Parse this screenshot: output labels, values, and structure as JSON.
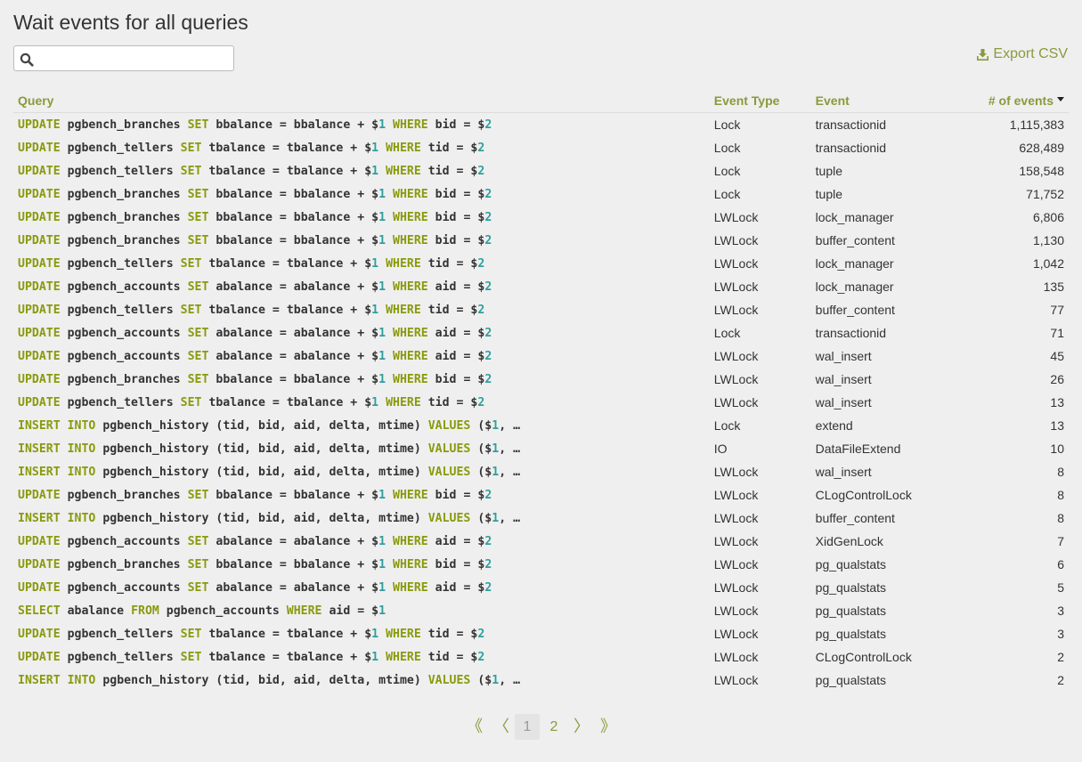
{
  "page": {
    "title": "Wait events for all queries"
  },
  "search": {
    "value": "",
    "placeholder": ""
  },
  "toolbar": {
    "export_label": "Export CSV"
  },
  "table": {
    "headers": {
      "query": "Query",
      "event_type": "Event Type",
      "event": "Event",
      "count": "# of events"
    },
    "sort": {
      "column": "count",
      "direction": "desc"
    },
    "rows": [
      {
        "query": "UPDATE pgbench_branches SET bbalance = bbalance + $1 WHERE bid = $2",
        "event_type": "Lock",
        "event": "transactionid",
        "count": "1,115,383"
      },
      {
        "query": "UPDATE pgbench_tellers SET tbalance = tbalance + $1 WHERE tid = $2",
        "event_type": "Lock",
        "event": "transactionid",
        "count": "628,489"
      },
      {
        "query": "UPDATE pgbench_tellers SET tbalance = tbalance + $1 WHERE tid = $2",
        "event_type": "Lock",
        "event": "tuple",
        "count": "158,548"
      },
      {
        "query": "UPDATE pgbench_branches SET bbalance = bbalance + $1 WHERE bid = $2",
        "event_type": "Lock",
        "event": "tuple",
        "count": "71,752"
      },
      {
        "query": "UPDATE pgbench_branches SET bbalance = bbalance + $1 WHERE bid = $2",
        "event_type": "LWLock",
        "event": "lock_manager",
        "count": "6,806"
      },
      {
        "query": "UPDATE pgbench_branches SET bbalance = bbalance + $1 WHERE bid = $2",
        "event_type": "LWLock",
        "event": "buffer_content",
        "count": "1,130"
      },
      {
        "query": "UPDATE pgbench_tellers SET tbalance = tbalance + $1 WHERE tid = $2",
        "event_type": "LWLock",
        "event": "lock_manager",
        "count": "1,042"
      },
      {
        "query": "UPDATE pgbench_accounts SET abalance = abalance + $1 WHERE aid = $2",
        "event_type": "LWLock",
        "event": "lock_manager",
        "count": "135"
      },
      {
        "query": "UPDATE pgbench_tellers SET tbalance = tbalance + $1 WHERE tid = $2",
        "event_type": "LWLock",
        "event": "buffer_content",
        "count": "77"
      },
      {
        "query": "UPDATE pgbench_accounts SET abalance = abalance + $1 WHERE aid = $2",
        "event_type": "Lock",
        "event": "transactionid",
        "count": "71"
      },
      {
        "query": "UPDATE pgbench_accounts SET abalance = abalance + $1 WHERE aid = $2",
        "event_type": "LWLock",
        "event": "wal_insert",
        "count": "45"
      },
      {
        "query": "UPDATE pgbench_branches SET bbalance = bbalance + $1 WHERE bid = $2",
        "event_type": "LWLock",
        "event": "wal_insert",
        "count": "26"
      },
      {
        "query": "UPDATE pgbench_tellers SET tbalance = tbalance + $1 WHERE tid = $2",
        "event_type": "LWLock",
        "event": "wal_insert",
        "count": "13"
      },
      {
        "query": "INSERT INTO pgbench_history (tid, bid, aid, delta, mtime) VALUES ($1, …",
        "event_type": "Lock",
        "event": "extend",
        "count": "13"
      },
      {
        "query": "INSERT INTO pgbench_history (tid, bid, aid, delta, mtime) VALUES ($1, …",
        "event_type": "IO",
        "event": "DataFileExtend",
        "count": "10"
      },
      {
        "query": "INSERT INTO pgbench_history (tid, bid, aid, delta, mtime) VALUES ($1, …",
        "event_type": "LWLock",
        "event": "wal_insert",
        "count": "8"
      },
      {
        "query": "UPDATE pgbench_branches SET bbalance = bbalance + $1 WHERE bid = $2",
        "event_type": "LWLock",
        "event": "CLogControlLock",
        "count": "8"
      },
      {
        "query": "INSERT INTO pgbench_history (tid, bid, aid, delta, mtime) VALUES ($1, …",
        "event_type": "LWLock",
        "event": "buffer_content",
        "count": "8"
      },
      {
        "query": "UPDATE pgbench_accounts SET abalance = abalance + $1 WHERE aid = $2",
        "event_type": "LWLock",
        "event": "XidGenLock",
        "count": "7"
      },
      {
        "query": "UPDATE pgbench_branches SET bbalance = bbalance + $1 WHERE bid = $2",
        "event_type": "LWLock",
        "event": "pg_qualstats",
        "count": "6"
      },
      {
        "query": "UPDATE pgbench_accounts SET abalance = abalance + $1 WHERE aid = $2",
        "event_type": "LWLock",
        "event": "pg_qualstats",
        "count": "5"
      },
      {
        "query": "SELECT abalance FROM pgbench_accounts WHERE aid = $1",
        "event_type": "LWLock",
        "event": "pg_qualstats",
        "count": "3"
      },
      {
        "query": "UPDATE pgbench_tellers SET tbalance = tbalance + $1 WHERE tid = $2",
        "event_type": "LWLock",
        "event": "pg_qualstats",
        "count": "3"
      },
      {
        "query": "UPDATE pgbench_tellers SET tbalance = tbalance + $1 WHERE tid = $2",
        "event_type": "LWLock",
        "event": "CLogControlLock",
        "count": "2"
      },
      {
        "query": "INSERT INTO pgbench_history (tid, bid, aid, delta, mtime) VALUES ($1, …",
        "event_type": "LWLock",
        "event": "pg_qualstats",
        "count": "2"
      }
    ]
  },
  "pagination": {
    "first": "《",
    "prev": "〈",
    "next": "〉",
    "last": "》",
    "pages": [
      "1",
      "2"
    ],
    "current": "1"
  },
  "colors": {
    "accent": "#8a9a3b",
    "keyword": "#8a9a0c",
    "param": "#2f9e9e",
    "background": "#efefef"
  },
  "icons": {
    "search": "search-icon",
    "export": "download-icon",
    "sort": "caret-down-icon"
  }
}
